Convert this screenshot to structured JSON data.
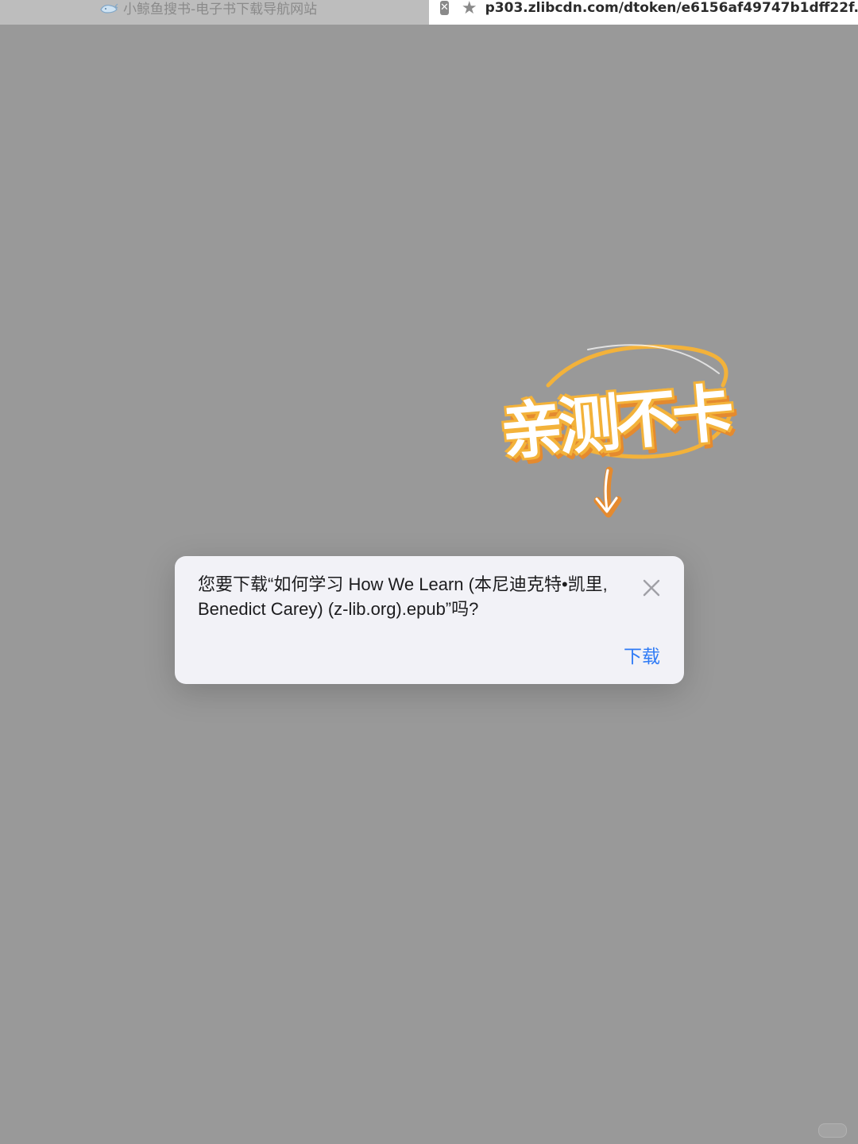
{
  "tabs": [
    {
      "title": "小鲸鱼搜书-电子书下载导航网站",
      "favicon": "whale-icon",
      "active": false
    },
    {
      "title": "p303.zlibcdn.com/dtoken/e6156af49747b1dff22f...",
      "active": true,
      "icons": [
        "close-icon",
        "star-icon"
      ]
    }
  ],
  "sticker": {
    "text": "亲测不卡",
    "icon": "arrow-down-icon"
  },
  "dialog": {
    "message": "您要下载“如何学习 How We Learn (本尼迪克特•凯里, Benedict Carey) (z-lib.org).epub”吗?",
    "download_label": "下载",
    "close_icon": "close-icon"
  },
  "colors": {
    "background": "#999999",
    "dialog": "#f2f2f7",
    "accent": "#2f7bf6",
    "sticker_outline": "#f3b23a"
  }
}
